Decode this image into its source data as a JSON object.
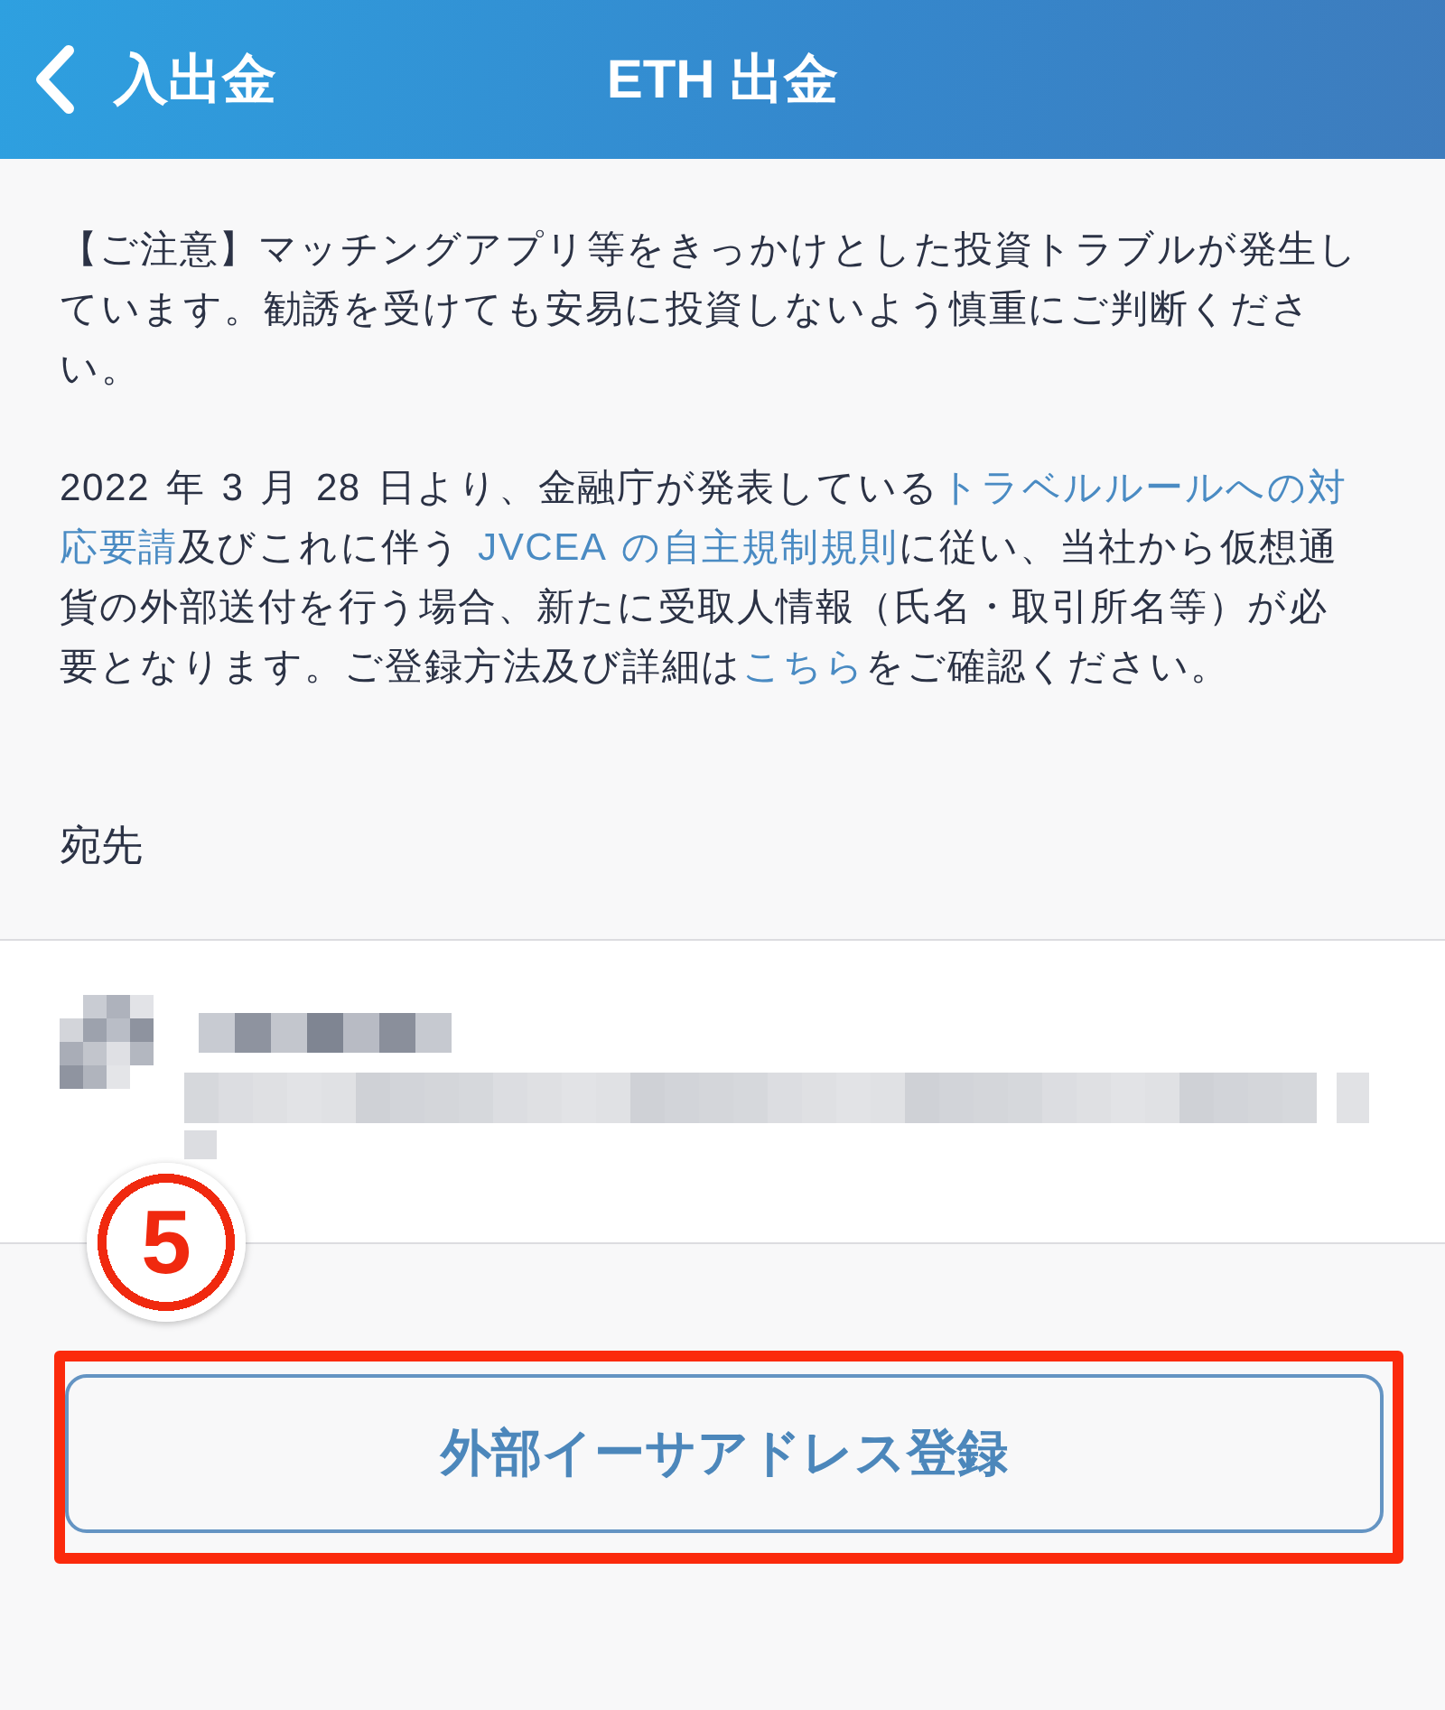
{
  "header": {
    "back_label": "入出金",
    "title": "ETH 出金"
  },
  "notice": [
    [
      {
        "kind": "text",
        "text": "【ご注意】マッチングアプリ等をきっかけとした投資トラブルが発生しています。勧誘を受けても安易に投資しないよう慎重にご判断ください。"
      }
    ],
    [
      {
        "kind": "text",
        "text": "2022 年 3 月 28 日より、金融庁が発表している"
      },
      {
        "kind": "link",
        "text": "トラベルルールへの対"
      },
      {
        "kind": "link",
        "text": "応要請"
      },
      {
        "kind": "text",
        "text": "及びこれに伴う "
      },
      {
        "kind": "link",
        "text": "JVCEA の自主規制規則"
      },
      {
        "kind": "text",
        "text": "に従い、当社から仮想通貨の外部送付を行う場合、新たに受取人情報（氏名・取引所名等）が必要となります。ご登録方法及び詳細は"
      },
      {
        "kind": "link",
        "text": "こちら"
      },
      {
        "kind": "text",
        "text": "をご確認ください。"
      }
    ]
  ],
  "destination_section": {
    "heading": "宛先",
    "items": [
      {
        "kind": "redacted"
      }
    ]
  },
  "annotation": {
    "step_badge": "5"
  },
  "register_button": {
    "label": "外部イーサアドレス登録",
    "highlighted": true
  }
}
